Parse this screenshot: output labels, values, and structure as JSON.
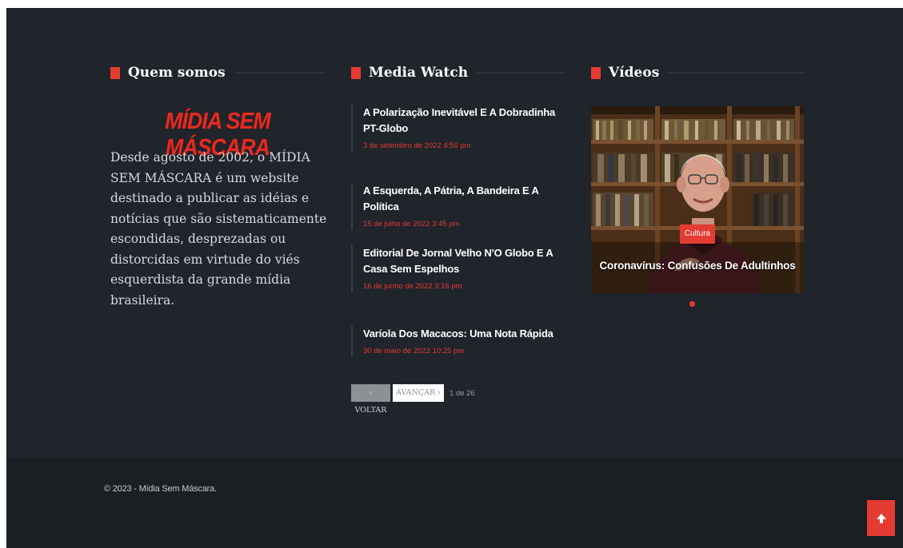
{
  "about": {
    "title": "Quem somos",
    "logo_text": "MÍDIA SEM MÁSCARA",
    "text": "Desde agosto de 2002, o MÍDIA SEM MÁSCARA é um website destinado a publicar as idéias e notícias que são sistematicamente escondidas, desprezadas ou distorcidas em virtude do viés esquerdista da grande mídia brasileira."
  },
  "media_watch": {
    "title": "Media Watch",
    "posts": [
      {
        "title": "A Polarização Inevitável E A Dobradinha PT-Globo",
        "date": "3 de setembro de 2022 4:56 pm"
      },
      {
        "title": "A Esquerda, A Pátria, A Bandeira E A Política",
        "date": "15 de julho de 2022 3:45 pm"
      },
      {
        "title": "Editorial De Jornal Velho N'O Globo E A Casa Sem Espelhos",
        "date": "16 de junho de 2022 3:16 pm"
      },
      {
        "title": "Varíola Dos Macacos: Uma Nota Rápida",
        "date": "30 de maio de 2022 10:25 pm"
      }
    ],
    "pagination": {
      "prev": "‹ VOLTAR",
      "next": "AVANÇAR ›",
      "count": "1 de 26"
    }
  },
  "videos": {
    "title": "Vídeos",
    "current": {
      "category": "Cultura",
      "title": "Coronavírus: Confusões De Adultinhos"
    },
    "slide_indicator_icon": "dot-icon"
  },
  "footer": {
    "copyright": "© 2023 - Mídia Sem Máscara.",
    "scroll_top_icon": "arrow-up-icon"
  },
  "colors": {
    "accent": "#e43b33",
    "background": "#20242b",
    "footer_bg": "#1b1e23"
  }
}
